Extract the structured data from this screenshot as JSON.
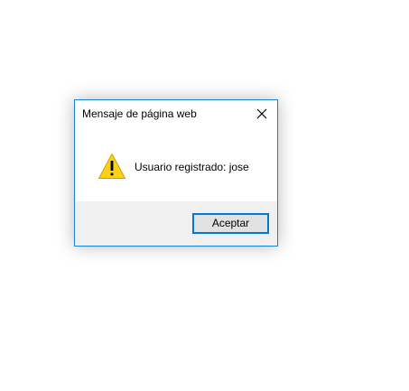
{
  "dialog": {
    "title": "Mensaje de página web",
    "message": "Usuario registrado: jose",
    "ok_label": "Aceptar",
    "icon": "warning-icon",
    "close_icon": "close-icon"
  },
  "colors": {
    "border": "#1883d7",
    "footer_bg": "#f0f0f0",
    "button_bg": "#e1e1e1",
    "button_border": "#0078d7",
    "warning_yellow": "#fcd116"
  }
}
